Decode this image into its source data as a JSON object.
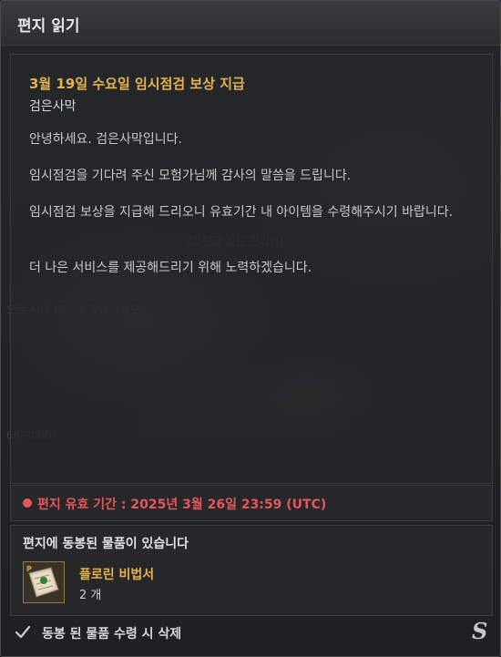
{
  "window": {
    "title": "편지 읽기"
  },
  "letter": {
    "subject": "3월 19일 수요일 임시점검 보상 지급",
    "sender": "검은사막",
    "paragraphs": [
      "안녕하세요. 검은사막입니다.",
      "임시점검을 기다려 주신 모험가님께 감사의 말씀을 드립니다.",
      "임시점검 보상을 지급해 드리오니 유효기간 내 아이템을 수령해주시기 바랍니다.",
      "더 나은 서비스를 제공해드리기 위해 노력하겠습니다."
    ]
  },
  "background": {
    "ghost_1": "(그림말 길드 관리인)",
    "ghost_2": "으로 사막 NPC를 찾아가세요.",
    "ghost_3": "68/2000)"
  },
  "expiry": {
    "text": "편지 유효 기간 : 2025년 3월 26일 23:59 (UTC)"
  },
  "attachments": {
    "header": "편지에 동봉된 물품이 있습니다",
    "items": [
      {
        "name": "플로린 비법서",
        "count": "2 개",
        "icon": "recipe-book-icon"
      }
    ]
  },
  "footer": {
    "delete_option_label": "동봉 된 물품 수령 시 삭제",
    "checked": true
  },
  "colors": {
    "accent_gold": "#e4b44c",
    "expiry_red": "#e0575c",
    "panel": "#26272a"
  }
}
